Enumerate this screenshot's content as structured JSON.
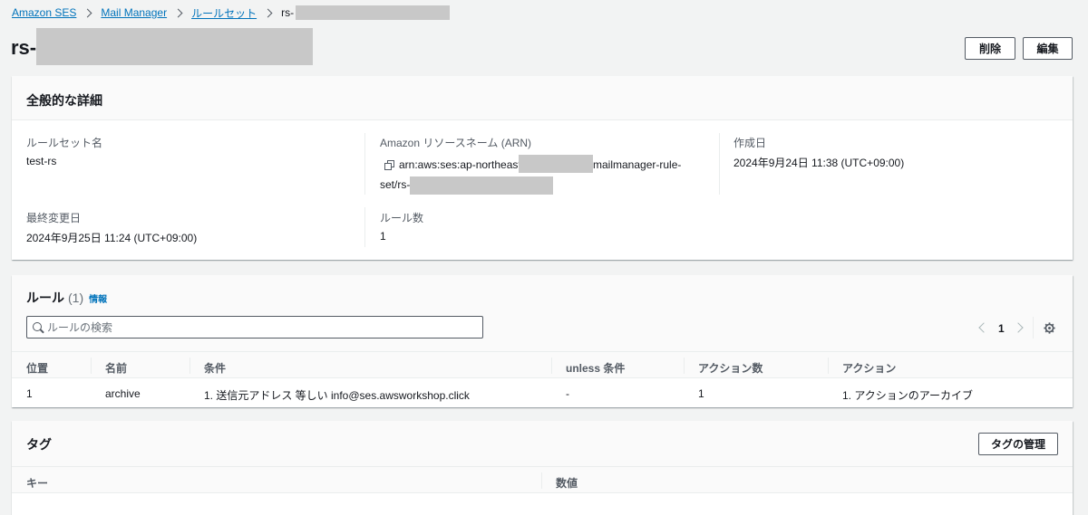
{
  "breadcrumb": {
    "items": [
      "Amazon SES",
      "Mail Manager",
      "ルールセット"
    ],
    "current_prefix": "rs-"
  },
  "header": {
    "title_prefix": "rs-",
    "delete_label": "削除",
    "edit_label": "編集"
  },
  "general": {
    "title": "全般的な詳細",
    "ruleset_name_label": "ルールセット名",
    "ruleset_name": "test-rs",
    "arn_label": "Amazon リソースネーム (ARN)",
    "arn_part1": "arn:aws:ses:ap-northeast-1:",
    "arn_part2": "mailmanager-rule-",
    "arn_part3": "set/rs-",
    "created_label": "作成日",
    "created": "2024年9月24日 11:38 (UTC+09:00)",
    "modified_label": "最終変更日",
    "modified": "2024年9月25日 11:24 (UTC+09:00)",
    "rule_count_label": "ルール数",
    "rule_count": "1"
  },
  "rules": {
    "title": "ルール",
    "count": "(1)",
    "info": "情報",
    "search_placeholder": "ルールの検索",
    "page": "1",
    "columns": [
      "位置",
      "名前",
      "条件",
      "unless 条件",
      "アクション数",
      "アクション"
    ],
    "rows": [
      [
        "1",
        "archive",
        "1. 送信元アドレス 等しい info@ses.awsworkshop.click",
        "-",
        "1",
        "1. アクションのアーカイブ"
      ]
    ]
  },
  "tags": {
    "title": "タグ",
    "manage_label": "タグの管理",
    "columns": [
      "キー",
      "数値"
    ]
  }
}
